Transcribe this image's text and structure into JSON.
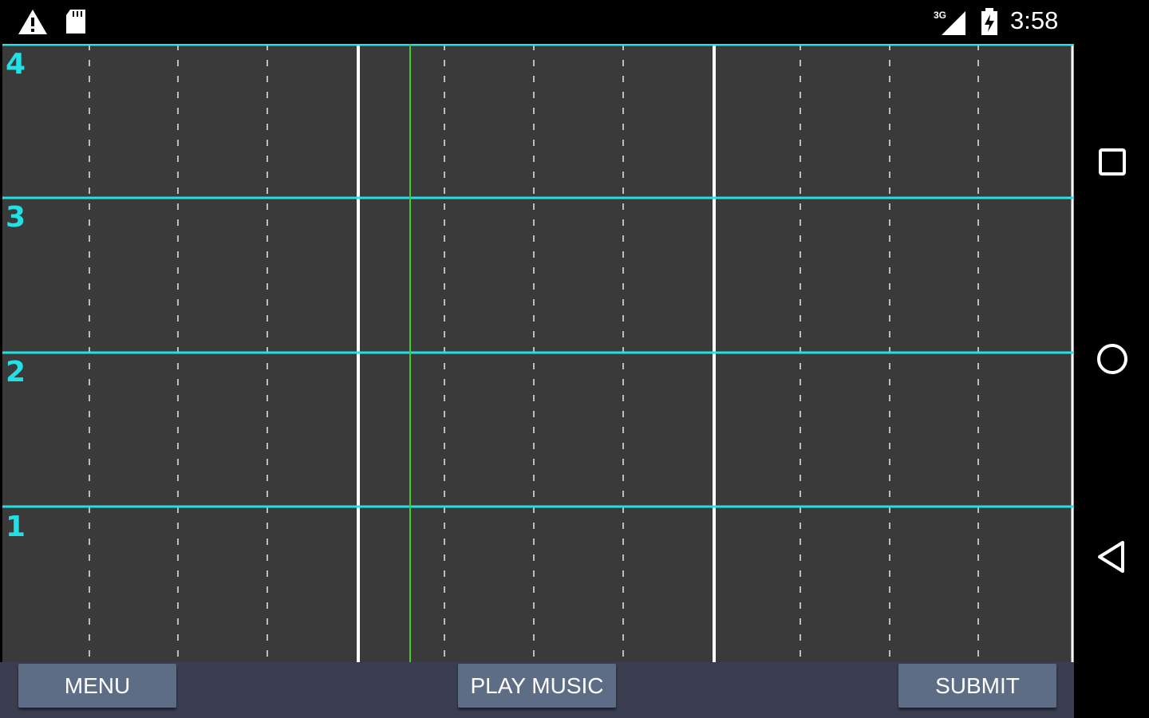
{
  "status_bar": {
    "time": "3:58",
    "network": "3G",
    "icons": [
      "warning-icon",
      "sd-card-icon",
      "signal-icon",
      "battery-charging-icon"
    ]
  },
  "grid": {
    "rows": [
      "4",
      "3",
      "2",
      "1"
    ],
    "line_color": "#22e0e6",
    "playhead_color": "#44cc22",
    "background": "#3a3a3a"
  },
  "buttons": {
    "menu": "MENU",
    "play_music": "PLAY MUSIC",
    "submit": "SUBMIT"
  },
  "nav": {
    "icons": [
      "recent-apps-icon",
      "home-icon",
      "back-icon"
    ]
  }
}
